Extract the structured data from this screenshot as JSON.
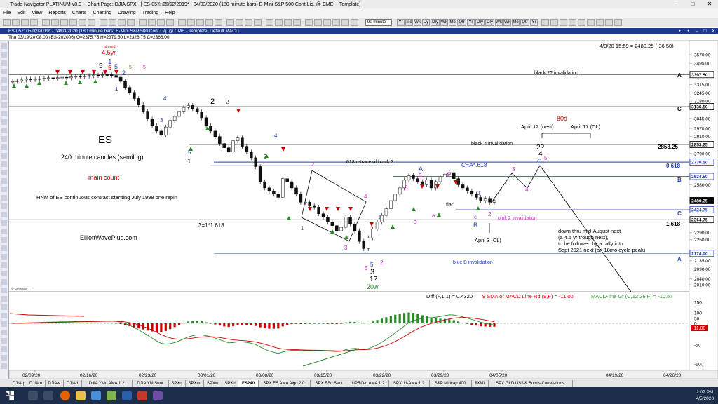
{
  "window": {
    "title": "Trade Navigator PLATINUM v8.0  --  Chart Page: DJIA SPX - [ ES-057: 05/02/2019* - 04/03/2020 (180 minute bars)  E-Mini S&P 500 Cont Liq. @ CME  --  Template]",
    "status": "Status:"
  },
  "menu": [
    "File",
    "Edit",
    "View",
    "Reports",
    "Charts",
    "Charting",
    "Drawing",
    "Trading",
    "Help"
  ],
  "toolbar": {
    "interval": "90 minute",
    "timeframes": [
      "Yr",
      "Mo",
      "Wk",
      "Dy",
      "Dly",
      "Wk",
      "Mo",
      "Qtr",
      "Yr",
      "Dly",
      "Dly",
      "Wk",
      "Wk",
      "Mo",
      "Qtr",
      "Yr"
    ]
  },
  "chart_header": {
    "title": "ES-057: 05/02/2019* - 04/03/2020 (180 minute bars)   E-Mini S&P 500 Cont Liq. @ CME  -  Template: Default MACD",
    "info": "Thu  03/19/20 08:00 (ES-202006)  O=2375.75  H=2379.50  L=2326.75  C=2366.00"
  },
  "price_panel": {
    "readout": "4/3/20 15:59 = 2480.25 (-36.50)",
    "y_ticks": [
      "3570.00",
      "3495.00",
      "3397.50",
      "3315.00",
      "3245.00",
      "3180.00",
      "3136.50",
      "3045.00",
      "2970.00",
      "2910.00",
      "2853.25",
      "2790.00",
      "2730.50",
      "2634.50",
      "2580.00",
      "2480.25",
      "2424.75",
      "2364.75",
      "2290.00",
      "2250.00",
      "2174.00",
      "2135.00",
      "2090.00",
      "2040.00",
      "2010.00"
    ],
    "level_labels": {
      "l1": "black 2? invalidation",
      "l2": "black 4 invalidation",
      "l3": ".618 retrace of black 3",
      "l4": "C=A*.618",
      "l5": "3=1*1.618",
      "l6": "pink 2 invalidation",
      "l7": "blue B invalidation"
    },
    "level_tags": {
      "a": "A",
      "c": "C",
      "b": "B",
      "c2": "C",
      "a2": "A",
      "v2853": "2853.25",
      "v618": "0.618",
      "v1618": "1.618"
    },
    "price_boxes": {
      "p1": "3397.50",
      "p2": "3136.50",
      "p3": "2853.25",
      "p4": "2730.50",
      "p5": "2634.50",
      "p6": "2480.25",
      "p7": "2424.75",
      "p8": "2364.75",
      "p9": "2174.00"
    },
    "annotations": {
      "es": "ES",
      "candles": "240 minute candles (semilog)",
      "main_count": "main count",
      "hnm": "HNM of ES continuous contract startting July 1998 one repin",
      "site": "ElliottWavePlus.com",
      "eighty": "80d",
      "apr12": "April 12 (nest)",
      "apr17": "April 17 (CL)",
      "apr3": "April 3 (CL)",
      "flat": "flat",
      "forecast": [
        "down thru mid-August next",
        "(a 4.5 yr trough nest),",
        "to be followed by a rally into",
        "Sept 2021 next (an 18mo cycle peak)"
      ],
      "pinned": "pinned",
      "cycle": "4.5yr",
      "twenty": "20w",
      "q1": "1?",
      "copyright": "© GenesisFT"
    },
    "wave_labels": {
      "w_top_5": "5",
      "w_top_1a": "1",
      "w_top_1b": "1",
      "w_top_5r": "5",
      "w_top_5g": "5",
      "w_top_5o": "5",
      "w_top_5p": "5",
      "w_top_2": "2",
      "w_top_1c": "1",
      "w_4a": "4",
      "w_3a": "3",
      "w_5a": "5",
      "w_1b": "1",
      "w_2b": "2",
      "w_2c": "2",
      "w_4b": "4",
      "w_3b": "3",
      "w_p2": "2",
      "w_p1": "1",
      "w_p3": "3",
      "w_p4": "4",
      "w_p1b": "1",
      "w_p5": "5",
      "w_p3b": "3",
      "w_3low": "3",
      "w_5low": "5",
      "w_2low": "2",
      "w_A": "A",
      "w_5m": "5",
      "w_b": "b",
      "w_a": "a",
      "w_3m": "3",
      "w_c": "c",
      "w_B": "B",
      "w_1m": "1",
      "w_2m": "2",
      "w_3r": "3",
      "w_4r": "4",
      "w_qq": "2?",
      "w_4c": "4",
      "w_Cc": "C",
      "w_5c": "5"
    }
  },
  "macd_panel": {
    "title_diff": "Diff (F,1,1) = 0.4320",
    "title_sma": "9 SMA of MACD Line Rd (9,F) = -11.00",
    "title_macd": "MACD-line Gr (C,12,26,F) = -10.57",
    "y_ticks": [
      "150",
      "100",
      "50",
      "0",
      "-11.00",
      "-50",
      "-100"
    ]
  },
  "x_axis": {
    "dates": [
      "02/09/20",
      "02/16/20",
      "02/23/20",
      "03/01/20",
      "03/08/20",
      "03/15/20",
      "03/22/20",
      "03/29/20",
      "04/05/20",
      "04/19/20",
      "04/26/20"
    ]
  },
  "tabs": [
    "DJIAq",
    "DJIAm",
    "DJIAw",
    "DJIAd",
    "DJIA YMd AMA 1.2",
    "DJIA YM Sent",
    "SPXq",
    "SPXm",
    "SPXw",
    "SPXd",
    "ES240",
    "SPX ES AMA Algo 2.0",
    "SPX ESd Sent",
    "UPRO-d AMA 1.2",
    "SPXUd-AMA 1.2",
    "S&P Midcap 400",
    "$XMI",
    "SPX GLD US$ & Bonds Correlations"
  ],
  "active_tab": "ES240",
  "taskbar": {
    "time": "2:07 PM",
    "date": "4/5/2020"
  },
  "colors": {
    "title_bar": "#1f3a8c",
    "blue_label": "#1f3fbf",
    "magenta": "#d22cd2",
    "red": "#cc0000",
    "green": "#2a8a2a"
  },
  "chart_data": {
    "type": "candlestick",
    "levels": [
      3397.5,
      3136.5,
      2853.25,
      2730.5,
      2634.5,
      2424.75,
      2364.75,
      2174.0
    ],
    "closes": [
      3340,
      3345,
      3352,
      3360,
      3355,
      3358,
      3362,
      3366,
      3370,
      3365,
      3372,
      3375,
      3370,
      3378,
      3382,
      3380,
      3385,
      3388,
      3392,
      3390,
      3396,
      3394,
      3390,
      3375,
      3340,
      3290,
      3250,
      3200,
      3150,
      3100,
      3040,
      2990,
      2950,
      2920,
      2980,
      3030,
      3060,
      3100,
      3130,
      3145,
      3120,
      3095,
      3050,
      2990,
      2950,
      2910,
      2860,
      2830,
      2800,
      2880,
      2900,
      2840,
      2800,
      2760,
      2700,
      2600,
      2560,
      2540,
      2520,
      2500,
      2620,
      2600,
      2560,
      2520,
      2470,
      2470,
      2450,
      2440,
      2400,
      2380,
      2350,
      2330,
      2300,
      2320,
      2380,
      2340,
      2300,
      2240,
      2200,
      2260,
      2310,
      2350,
      2390,
      2430,
      2480,
      2520,
      2560,
      2610,
      2640,
      2620,
      2600,
      2580,
      2610,
      2560,
      2600,
      2630,
      2650,
      2660,
      2620,
      2580,
      2560,
      2540,
      2520,
      2500,
      2480,
      2490,
      2470,
      2480
    ]
  }
}
